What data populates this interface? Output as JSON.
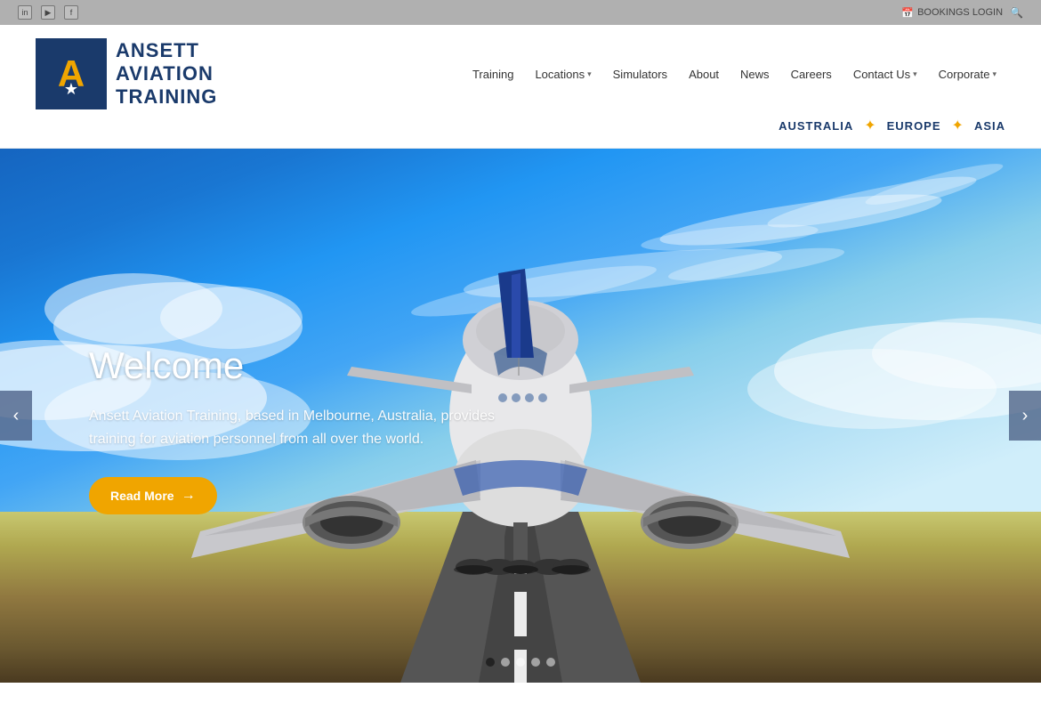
{
  "topbar": {
    "bookings_label": "BOOKINGS LOGIN",
    "social": [
      "linkedin",
      "youtube",
      "facebook"
    ]
  },
  "header": {
    "logo": {
      "letter": "A",
      "line1": "ANSETT",
      "line2": "AVIATION",
      "line3": "TRAINING"
    },
    "nav": [
      {
        "label": "Training",
        "has_dropdown": false
      },
      {
        "label": "Locations",
        "has_dropdown": true
      },
      {
        "label": "Simulators",
        "has_dropdown": false
      },
      {
        "label": "About",
        "has_dropdown": false
      },
      {
        "label": "News",
        "has_dropdown": false
      },
      {
        "label": "Careers",
        "has_dropdown": false
      },
      {
        "label": "Contact Us",
        "has_dropdown": true
      },
      {
        "label": "Corporate",
        "has_dropdown": true
      }
    ],
    "regions": [
      "AUSTRALIA",
      "EUROPE",
      "ASIA"
    ]
  },
  "hero": {
    "title": "Welcome",
    "description": "Ansett Aviation Training, based in Melbourne, Australia, provides training for aviation personnel from all over the world.",
    "cta_label": "Read More",
    "dots": [
      1,
      2,
      3,
      4,
      5
    ],
    "active_dot": 0
  }
}
